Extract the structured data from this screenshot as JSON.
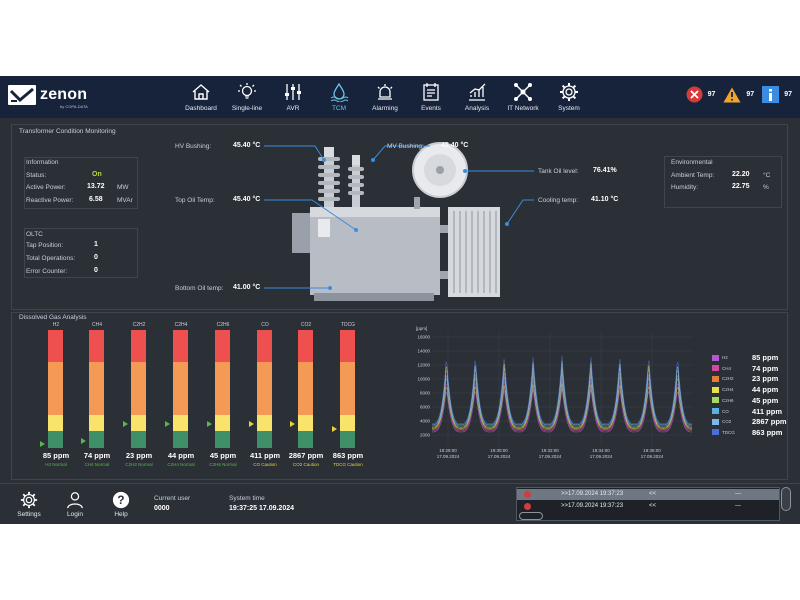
{
  "app": {
    "brand": "zenon",
    "brand_sub": "by COPA-DATA"
  },
  "nav": [
    {
      "label": "Dashboard",
      "icon": "home-icon"
    },
    {
      "label": "Single-line",
      "icon": "bulb-icon"
    },
    {
      "label": "AVR",
      "icon": "sliders-icon"
    },
    {
      "label": "TCM",
      "icon": "oil-drop-icon"
    },
    {
      "label": "Alarming",
      "icon": "alarm-icon"
    },
    {
      "label": "Events",
      "icon": "events-icon"
    },
    {
      "label": "Analysis",
      "icon": "analysis-icon"
    },
    {
      "label": "IT Network",
      "icon": "network-icon"
    },
    {
      "label": "System",
      "icon": "gear-icon"
    }
  ],
  "alarm_counts": {
    "error": "97",
    "warning": "97",
    "info": "97"
  },
  "tcm": {
    "title": "Transformer Condition Monitoring",
    "information": {
      "title": "Information",
      "status_label": "Status:",
      "status_value": "On",
      "active_power_label": "Active Power:",
      "active_power_value": "13.72",
      "active_power_unit": "MW",
      "reactive_power_label": "Reactive Power:",
      "reactive_power_value": "6.58",
      "reactive_power_unit": "MVAr"
    },
    "oltc": {
      "title": "OLTC",
      "tap_label": "Tap Position:",
      "tap_value": "1",
      "ops_label": "Total Operations:",
      "ops_value": "0",
      "err_label": "Error Counter:",
      "err_value": "0"
    },
    "environmental": {
      "title": "Environmental",
      "ambient_label": "Ambient Temp:",
      "ambient_value": "22.20",
      "ambient_unit": "°C",
      "humidity_label": "Humidity:",
      "humidity_value": "22.75",
      "humidity_unit": "%"
    },
    "hv_bushing_label": "HV Bushing:",
    "hv_bushing_value": "45.40 °C",
    "mv_bushing_label": "MV Bushing:",
    "mv_bushing_value": "45.40 °C",
    "top_oil_label": "Top Oil Temp:",
    "top_oil_value": "45.40 °C",
    "bottom_oil_label": "Bottom Oil temp:",
    "bottom_oil_value": "41.00 °C",
    "tank_oil_label": "Tank Oil level:",
    "tank_oil_value": "76.41%",
    "cooling_label": "Cooling temp:",
    "cooling_value": "41.10 °C"
  },
  "dga": {
    "title": "Dissolved Gas Analysis",
    "bars": [
      {
        "name": "H2",
        "value": "85 ppm",
        "status": "H2 Normal",
        "level": 0.03,
        "warn": false
      },
      {
        "name": "CH4",
        "value": "74 ppm",
        "status": "CH4 Normal",
        "level": 0.06,
        "warn": false
      },
      {
        "name": "C2H2",
        "value": "23 ppm",
        "status": "C2H2 Normal",
        "level": 0.2,
        "warn": false
      },
      {
        "name": "C2H4",
        "value": "44 ppm",
        "status": "C2H4 Normal",
        "level": 0.2,
        "warn": false
      },
      {
        "name": "C2H6",
        "value": "45 ppm",
        "status": "C2H6 Normal",
        "level": 0.2,
        "warn": false
      },
      {
        "name": "CO",
        "value": "411 ppm",
        "status": "CO Caution",
        "level": 0.2,
        "warn": true
      },
      {
        "name": "CO2",
        "value": "2867 ppm",
        "status": "CO2 Caution",
        "level": 0.2,
        "warn": true
      },
      {
        "name": "TDCG",
        "value": "863 ppm",
        "status": "TDCG Caution",
        "level": 0.16,
        "warn": true
      }
    ],
    "trend": {
      "y_unit": "[ppm]",
      "y_ticks": [
        "16000",
        "14000",
        "12000",
        "10000",
        "8000",
        "6000",
        "4000",
        "2000"
      ],
      "x_ticks": [
        {
          "time": "19:28:00",
          "date": "17.09.2024"
        },
        {
          "time": "19:30:00",
          "date": "17.09.2024"
        },
        {
          "time": "19:32:00",
          "date": "17.09.2024"
        },
        {
          "time": "19:34:00",
          "date": "17.09.2024"
        },
        {
          "time": "19:36:00",
          "date": "17.09.2024"
        }
      ]
    },
    "legend": [
      {
        "name": "H2",
        "value": "85 ppm",
        "color": "#b05ad0"
      },
      {
        "name": "CH4",
        "value": "74 ppm",
        "color": "#d04aa0"
      },
      {
        "name": "C2H2",
        "value": "23 ppm",
        "color": "#e07d3a"
      },
      {
        "name": "C2H4",
        "value": "44 ppm",
        "color": "#e8e04a"
      },
      {
        "name": "C2H6",
        "value": "45 ppm",
        "color": "#a8d860"
      },
      {
        "name": "CO",
        "value": "411 ppm",
        "color": "#5ab0e0"
      },
      {
        "name": "CO2",
        "value": "2867 ppm",
        "color": "#7fb8e8"
      },
      {
        "name": "TDCG",
        "value": "863 ppm",
        "color": "#4a70d8"
      }
    ]
  },
  "bottom": {
    "settings": "Settings",
    "login": "Login",
    "help": "Help",
    "current_user_label": "Current user",
    "current_user_value": "0000",
    "system_time_label": "System time",
    "system_time_value": "19:37:25 17.09.2024",
    "events": [
      {
        "time": ">>17.09.2024 19:37:23",
        "c2": "<<",
        "c3": "---"
      },
      {
        "time": ">>17.09.2024 19:37:23",
        "c2": "<<",
        "c3": "---"
      }
    ]
  }
}
